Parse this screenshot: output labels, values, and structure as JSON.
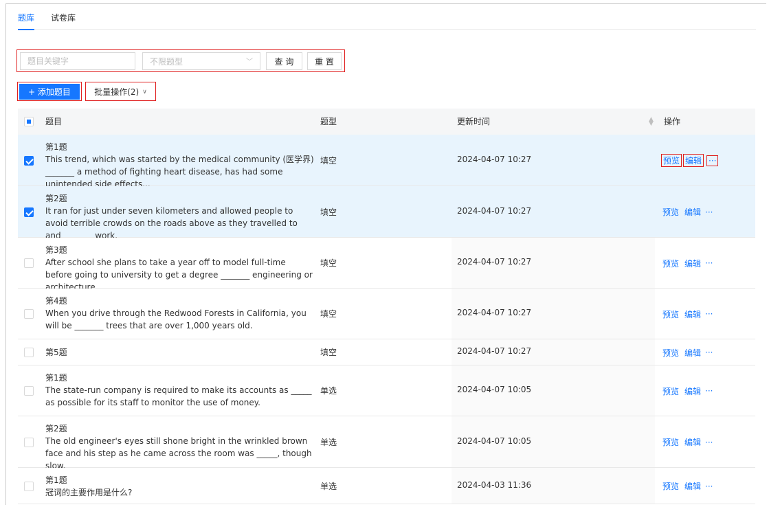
{
  "tabs": [
    "题库",
    "试卷库"
  ],
  "filter": {
    "keyword_placeholder": "题目关键字",
    "type_placeholder": "不限题型",
    "search_label": "查 询",
    "reset_label": "重 置"
  },
  "toolbar": {
    "add_label": "+ 添加题目",
    "batch_label": "批量操作(2)"
  },
  "table": {
    "headers": {
      "question": "题目",
      "type": "题型",
      "time": "更新时间",
      "ops": "操作"
    },
    "rows": [
      {
        "title": "第1题",
        "text": "This trend, which was started by the medical community (医学界) _______ a method of fighting heart disease, has had some unintended side effects...",
        "type": "填空",
        "time": "2024-04-07 10:27",
        "checked": true
      },
      {
        "title": "第2题",
        "text": "It ran for just under seven kilometers and allowed people to avoid terrible crowds on the roads above as they travelled to and _______ work.",
        "type": "填空",
        "time": "2024-04-07 10:27",
        "checked": true
      },
      {
        "title": "第3题",
        "text": "After school she plans to take a year off to model full-time before going to university to get a degree _______ engineering or architecture.",
        "type": "填空",
        "time": "2024-04-07 10:27",
        "checked": false
      },
      {
        "title": "第4题",
        "text": "When you drive through the Redwood Forests in California, you will be _______ trees that are over 1,000 years old.",
        "type": "填空",
        "time": "2024-04-07 10:27",
        "checked": false
      },
      {
        "title": "第5题",
        "text": "",
        "type": "填空",
        "time": "2024-04-07 10:27",
        "checked": false
      },
      {
        "title": "第1题",
        "text": "The state-run company is required to make its accounts as _____ as possible for its staff to monitor the use of money.",
        "type": "单选",
        "time": "2024-04-07 10:05",
        "checked": false
      },
      {
        "title": "第2题",
        "text": "The old engineer's eyes still shone bright in the wrinkled brown face and his step as he came across the room was _____, though slow.",
        "type": "单选",
        "time": "2024-04-07 10:05",
        "checked": false
      },
      {
        "title": "第1题",
        "text": "冠词的主要作用是什么?",
        "type": "单选",
        "time": "2024-04-03 11:36",
        "checked": false
      }
    ],
    "op_labels": {
      "preview": "预览",
      "edit": "编辑",
      "more": "···"
    }
  }
}
